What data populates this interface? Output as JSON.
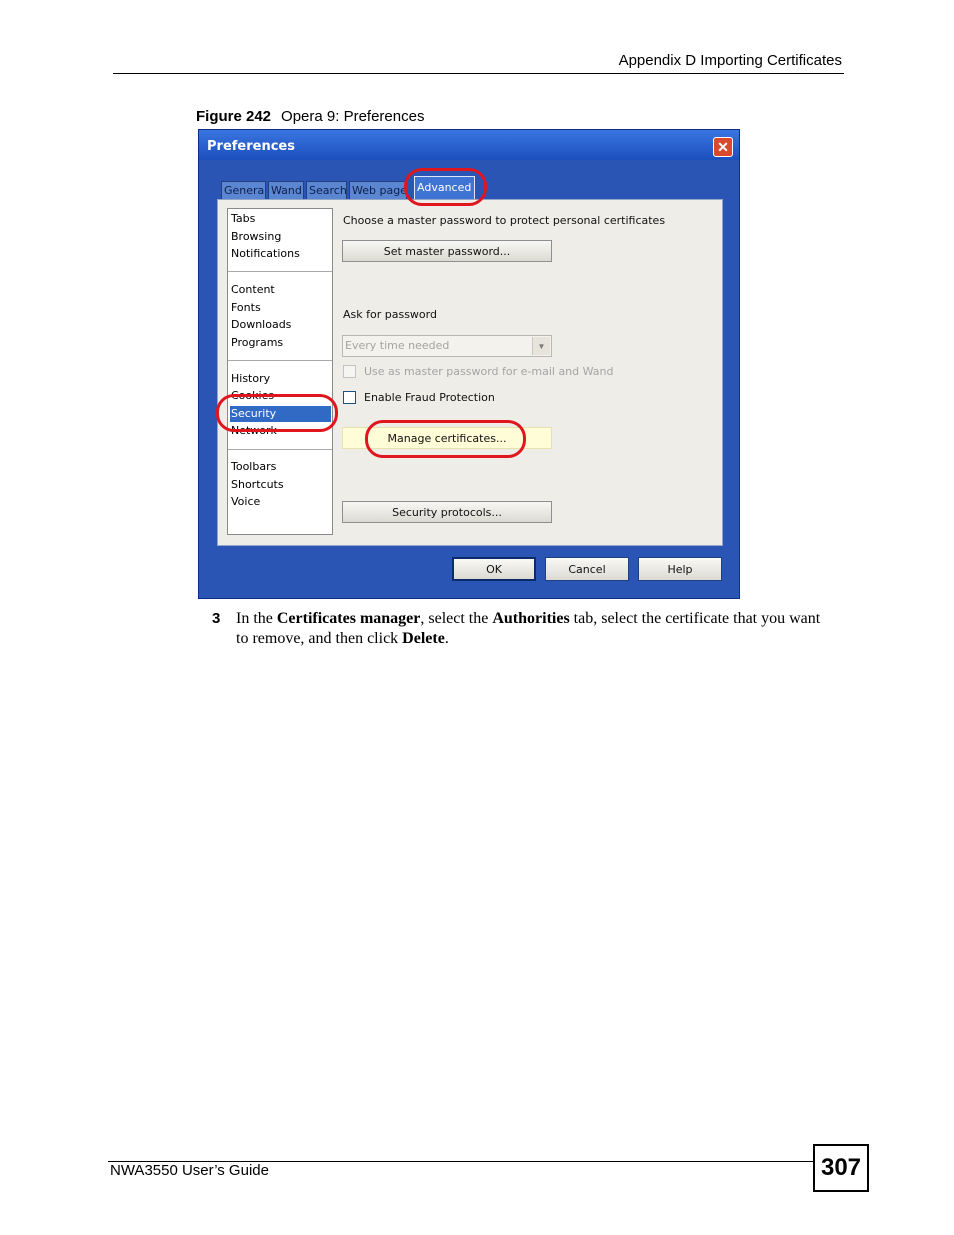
{
  "header": {
    "section": "Appendix D Importing Certificates"
  },
  "figure": {
    "label": "Figure 242",
    "caption": "Opera 9: Preferences"
  },
  "dialog": {
    "title": "Preferences",
    "close_glyph": "✕",
    "tabs": [
      "General",
      "Wand",
      "Search",
      "Web pages",
      "Advanced"
    ],
    "active_tab": "Advanced",
    "sidebar": {
      "items": [
        "Tabs",
        "Browsing",
        "Notifications",
        "Content",
        "Fonts",
        "Downloads",
        "Programs",
        "History",
        "Cookies",
        "Security",
        "Network",
        "Toolbars",
        "Shortcuts",
        "Voice"
      ],
      "selected": "Security"
    },
    "content": {
      "master_password_text": "Choose a master password to protect personal certificates",
      "set_master_password_button": "Set master password...",
      "ask_for_password_label": "Ask for password",
      "ask_for_password_value": "Every time needed",
      "use_as_master_checkbox": "Use as master password for e-mail and Wand",
      "fraud_protection_checkbox": "Enable Fraud Protection",
      "manage_certificates_button": "Manage certificates...",
      "security_protocols_button": "Security protocols..."
    },
    "buttons": {
      "ok": "OK",
      "cancel": "Cancel",
      "help": "Help"
    }
  },
  "step": {
    "number": "3",
    "t1": "In the ",
    "b1": "Certificates manager",
    "t2": ", select the ",
    "b2": "Authorities",
    "t3": " tab, select the certificate that you want to remove, and then click ",
    "b3": "Delete",
    "t4": "."
  },
  "footer": {
    "guide": "NWA3550 User’s Guide",
    "page_number": "307"
  }
}
